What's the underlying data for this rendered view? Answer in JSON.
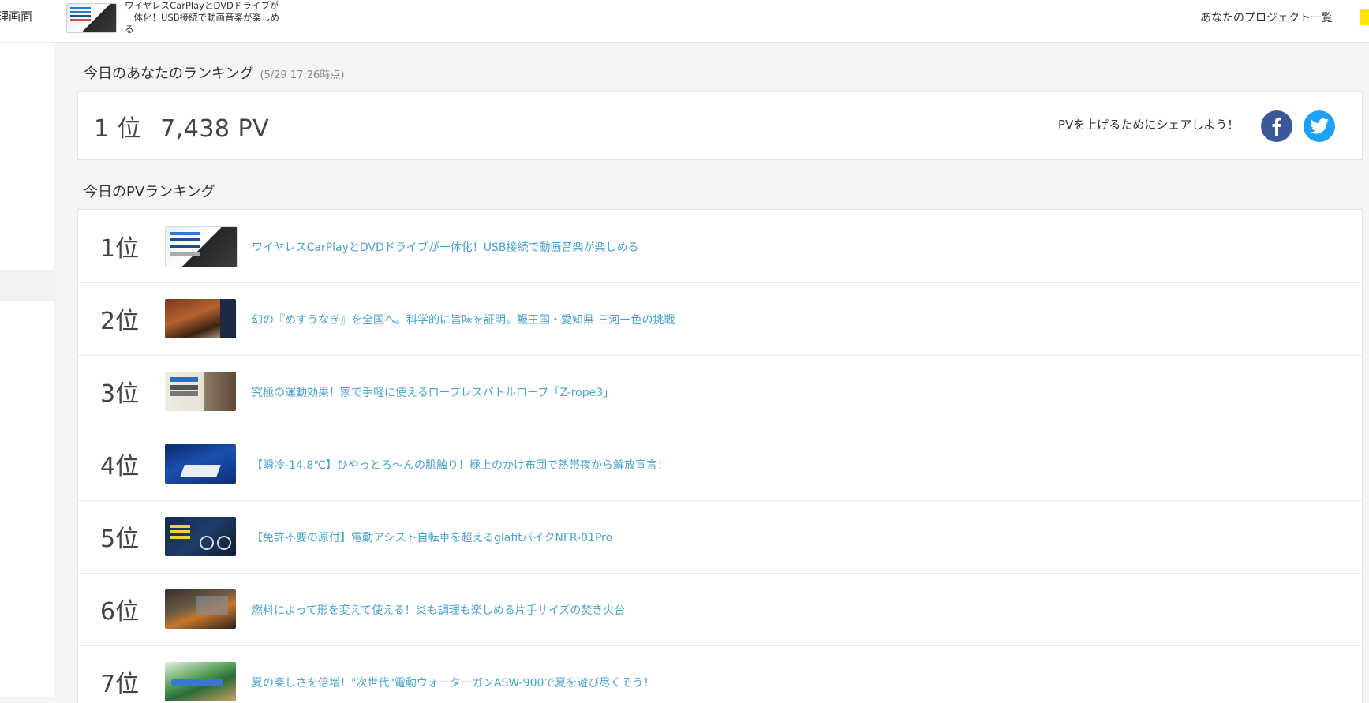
{
  "header": {
    "left_title": "理画面",
    "project_text": "ワイヤレスCarPlayとDVDドライブが一体化！USB接続で動画音楽が楽しめる",
    "projects_link": "あなたのプロジェクト一覧"
  },
  "today_ranking": {
    "title": "今日のあなたのランキング",
    "timestamp": "(5/29 17:26時点)",
    "rank": "1 位",
    "pv": "7,438 PV",
    "share_text": "PVを上げるためにシェアしよう！"
  },
  "pv_ranking": {
    "title": "今日のPVランキング",
    "items": [
      {
        "rank": "1位",
        "title": "ワイヤレスCarPlayとDVDドライブが一体化！USB接続で動画音楽が楽しめる"
      },
      {
        "rank": "2位",
        "title": "幻の『めすうなぎ』を全国へ。科学的に旨味を証明。鰻王国・愛知県 三河一色の挑戦"
      },
      {
        "rank": "3位",
        "title": "究極の運動効果！家で手軽に使えるロープレスバトルロープ「Z-rope3」"
      },
      {
        "rank": "4位",
        "title": "【瞬冷-14.8℃】ひやっとろ～んの肌触り！極上のかけ布団で熱帯夜から解放宣言！"
      },
      {
        "rank": "5位",
        "title": "【免許不要の原付】電動アシスト自転車を超えるglafitバイクNFR-01Pro"
      },
      {
        "rank": "6位",
        "title": "燃料によって形を変えて使える！炎も調理も楽しめる片手サイズの焚き火台"
      },
      {
        "rank": "7位",
        "title": "夏の楽しさを倍増！\"次世代\"電動ウォーターガンASW-900で夏を遊び尽くそう！"
      }
    ]
  },
  "colors": {
    "link": "#4aa3cf",
    "facebook": "#3b5998",
    "twitter": "#1da1f2"
  },
  "icons": [
    "facebook-icon",
    "twitter-icon"
  ]
}
